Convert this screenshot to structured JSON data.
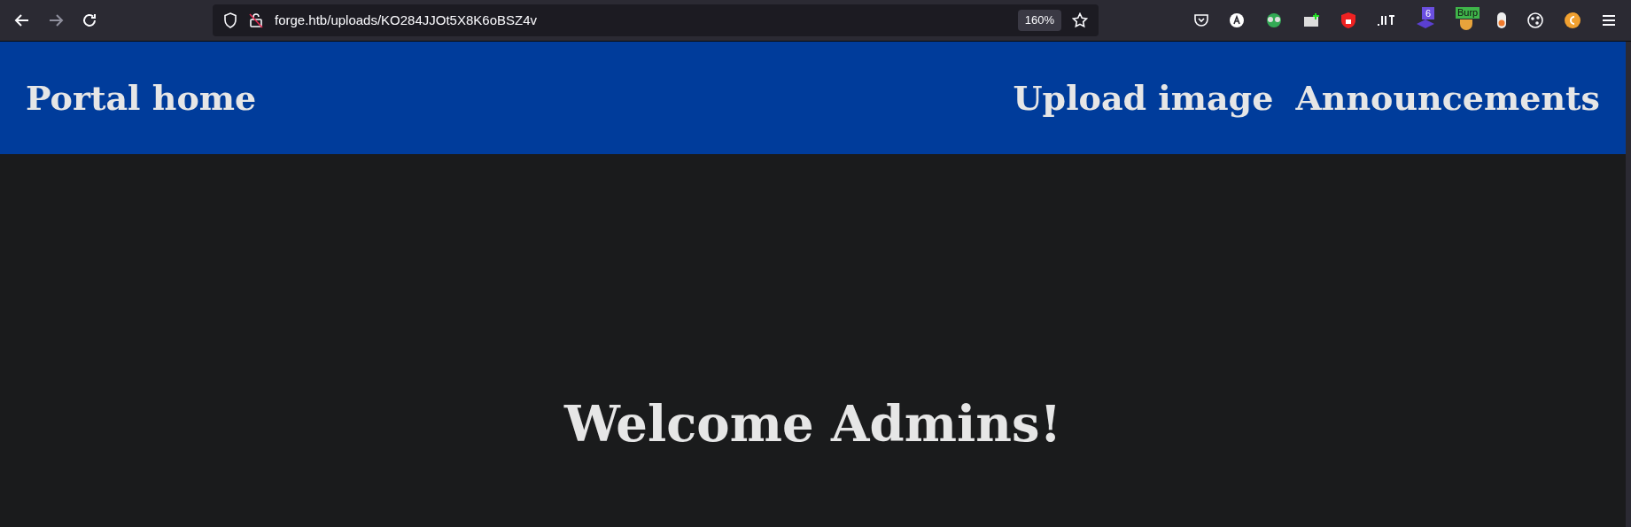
{
  "browser": {
    "url": "forge.htb/uploads/KO284JJOt5X8K6oBSZ4v",
    "zoom": "160%",
    "extension_badges": [
      "6",
      "Burp"
    ]
  },
  "nav": {
    "home": "Portal home",
    "links": [
      "Upload image",
      "Announcements"
    ]
  },
  "main": {
    "heading": "Welcome Admins!"
  }
}
